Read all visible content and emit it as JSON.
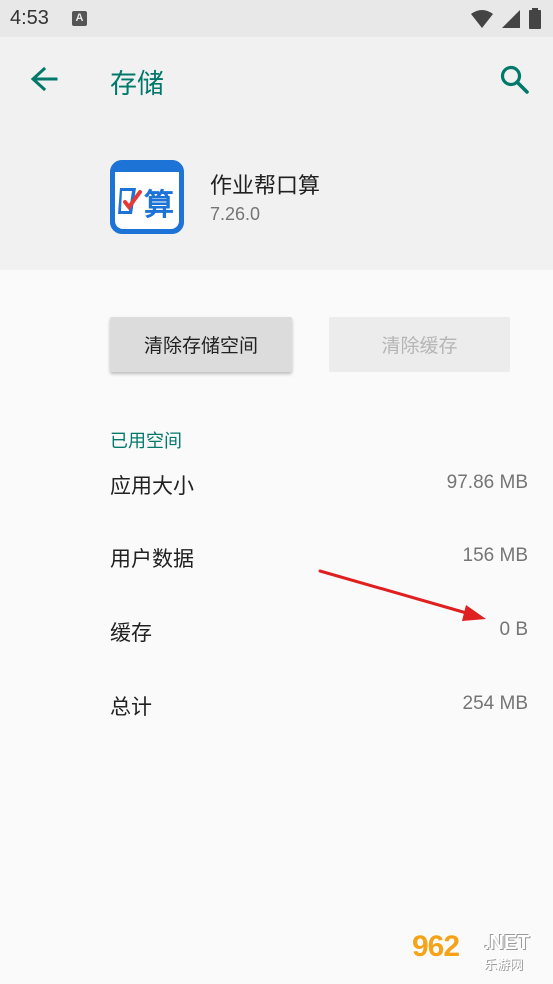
{
  "status_bar": {
    "time": "4:53",
    "notification_badge": "A",
    "icons": [
      "wifi-icon",
      "signal-icon",
      "battery-icon"
    ]
  },
  "header": {
    "title": "存储",
    "back_icon": "arrow-back-icon",
    "search_icon": "search-icon"
  },
  "app": {
    "name": "作业帮口算",
    "version": "7.26.0",
    "icon_text": "算"
  },
  "buttons": {
    "clear_storage": "清除存储空间",
    "clear_cache": "清除缓存"
  },
  "storage": {
    "section_label": "已用空间",
    "rows": [
      {
        "label": "应用大小",
        "value": "97.86 MB"
      },
      {
        "label": "用户数据",
        "value": "156 MB"
      },
      {
        "label": "缓存",
        "value": "0 B"
      },
      {
        "label": "总计",
        "value": "254 MB"
      }
    ]
  },
  "watermark": {
    "main": "962",
    "net": ".NET",
    "cn": "乐游网"
  },
  "colors": {
    "accent": "#00796b",
    "annotation_arrow": "#e02020",
    "watermark_orange": "#f7a21b",
    "app_icon_blue": "#1e73d6"
  }
}
